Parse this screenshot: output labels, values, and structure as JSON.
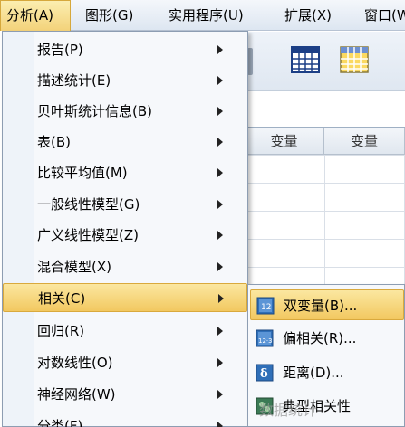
{
  "menubar": [
    {
      "label": "分析(A)",
      "active": true
    },
    {
      "label": "图形(G)"
    },
    {
      "label": "实用程序(U)"
    },
    {
      "label": "扩展(X)"
    },
    {
      "label": "窗口(W)"
    }
  ],
  "grid": {
    "headers": [
      "变量",
      "变量"
    ]
  },
  "analyze_menu": {
    "items": [
      {
        "label": "报告(P)",
        "submenu": true
      },
      {
        "label": "描述统计(E)",
        "submenu": true
      },
      {
        "label": "贝叶斯统计信息(B)",
        "submenu": true
      },
      {
        "label": "表(B)",
        "submenu": true
      },
      {
        "label": "比较平均值(M)",
        "submenu": true
      },
      {
        "label": "一般线性模型(G)",
        "submenu": true
      },
      {
        "label": "广义线性模型(Z)",
        "submenu": true
      },
      {
        "label": "混合模型(X)",
        "submenu": true
      },
      {
        "label": "相关(C)",
        "submenu": true,
        "highlighted": true
      },
      {
        "label": "回归(R)",
        "submenu": true
      },
      {
        "label": "对数线性(O)",
        "submenu": true
      },
      {
        "label": "神经网络(W)",
        "submenu": true
      },
      {
        "label": "分类(F)",
        "submenu": true
      }
    ]
  },
  "correlate_submenu": {
    "items": [
      {
        "label": "双变量(B)...",
        "icon": "bivariate-icon",
        "highlighted": true
      },
      {
        "label": "偏相关(R)...",
        "icon": "partial-correlation-icon"
      },
      {
        "label": "距离(D)...",
        "icon": "distance-icon"
      },
      {
        "label": "典型相关性",
        "icon": "canonical-correlation-icon"
      }
    ]
  },
  "watermark": "数据统计"
}
